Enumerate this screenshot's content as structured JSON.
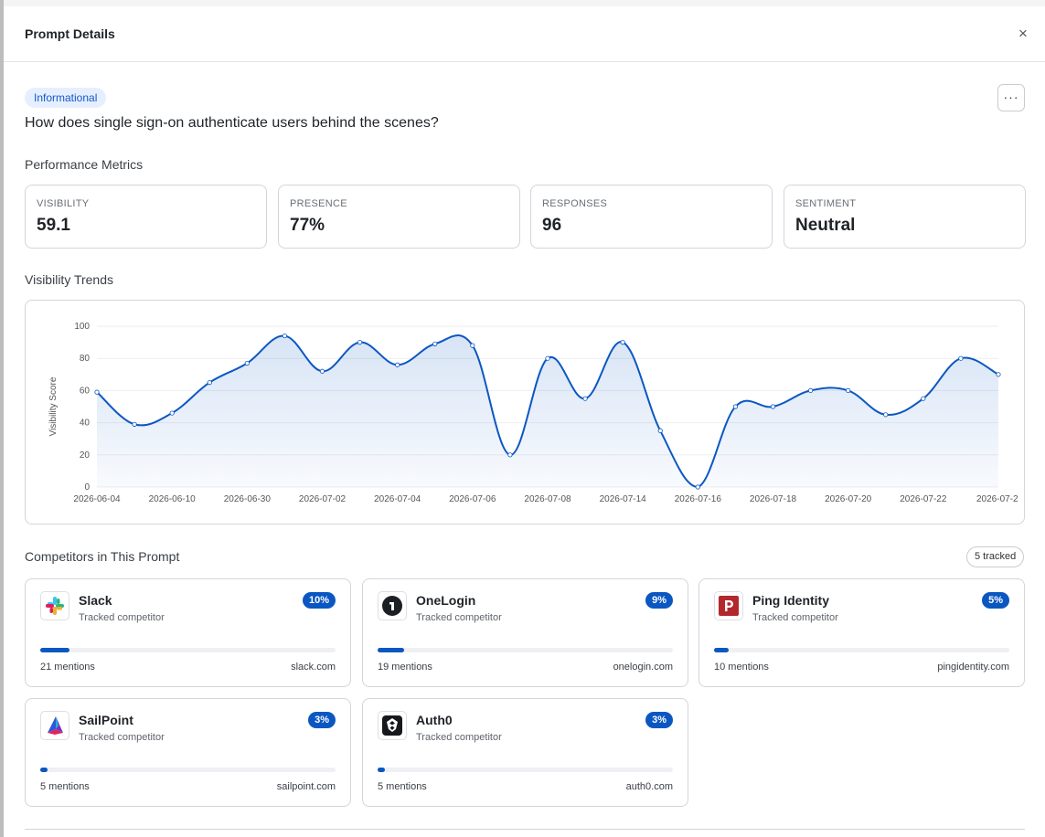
{
  "header": {
    "title": "Prompt Details",
    "close_label": "×"
  },
  "prompt": {
    "tag": "Informational",
    "more_label": "···",
    "question": "How does single sign-on authenticate users behind the scenes?"
  },
  "metrics": {
    "section_title": "Performance Metrics",
    "items": [
      {
        "label": "VISIBILITY",
        "value": "59.1"
      },
      {
        "label": "PRESENCE",
        "value": "77%"
      },
      {
        "label": "RESPONSES",
        "value": "96"
      },
      {
        "label": "SENTIMENT",
        "value": "Neutral"
      }
    ]
  },
  "trends": {
    "section_title": "Visibility Trends"
  },
  "chart_data": {
    "type": "area",
    "ylabel": "Visibility Score",
    "ylim": [
      0,
      100
    ],
    "yticks": [
      0,
      20,
      40,
      60,
      80,
      100
    ],
    "x_tick_labels": [
      "2026-06-04",
      "2026-06-10",
      "2026-06-30",
      "2026-07-02",
      "2026-07-04",
      "2026-07-06",
      "2026-07-08",
      "2026-07-14",
      "2026-07-16",
      "2026-07-18",
      "2026-07-20",
      "2026-07-22",
      "2026-07-2"
    ],
    "values": [
      59,
      39,
      46,
      65,
      77,
      94,
      72,
      90,
      76,
      89,
      88,
      20,
      80,
      55,
      90,
      35,
      0,
      50,
      50,
      60,
      60,
      45,
      55,
      80,
      70
    ],
    "line_color": "#0b57c2",
    "grid": true
  },
  "competitors": {
    "section_title": "Competitors in This Prompt",
    "tracked_badge": "5 tracked",
    "items": [
      {
        "name": "Slack",
        "subtitle": "Tracked competitor",
        "pct_label": "10%",
        "share": 10,
        "mentions": "21 mentions",
        "domain": "slack.com",
        "icon": "slack-logo-icon"
      },
      {
        "name": "OneLogin",
        "subtitle": "Tracked competitor",
        "pct_label": "9%",
        "share": 9,
        "mentions": "19 mentions",
        "domain": "onelogin.com",
        "icon": "onelogin-logo-icon"
      },
      {
        "name": "Ping Identity",
        "subtitle": "Tracked competitor",
        "pct_label": "5%",
        "share": 5,
        "mentions": "10 mentions",
        "domain": "pingidentity.com",
        "icon": "ping-identity-logo-icon"
      },
      {
        "name": "SailPoint",
        "subtitle": "Tracked competitor",
        "pct_label": "3%",
        "share": 3,
        "mentions": "5 mentions",
        "domain": "sailpoint.com",
        "icon": "sailpoint-logo-icon"
      },
      {
        "name": "Auth0",
        "subtitle": "Tracked competitor",
        "pct_label": "3%",
        "share": 3,
        "mentions": "5 mentions",
        "domain": "auth0.com",
        "icon": "auth0-logo-icon"
      }
    ]
  },
  "colors": {
    "accent": "#0b57c2",
    "tag_bg": "#e6efff",
    "tag_text": "#1458c7"
  }
}
